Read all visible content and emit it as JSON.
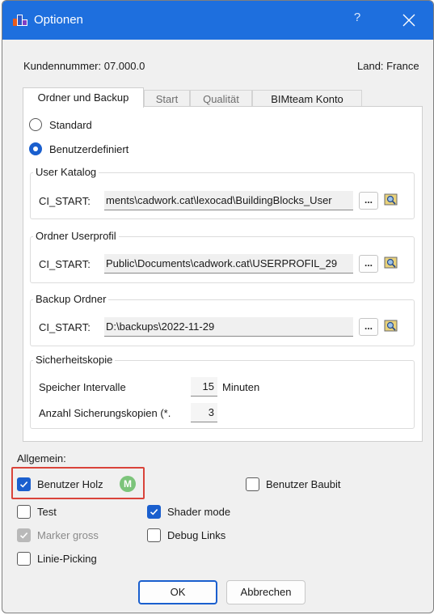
{
  "window": {
    "title": "Optionen",
    "help": "?"
  },
  "header": {
    "customer_number": "Kundennummer: 07.000.0",
    "country": "Land: France"
  },
  "tabs": [
    {
      "label": "Ordner und Backup",
      "state": "active"
    },
    {
      "label": "Start",
      "state": "inactive"
    },
    {
      "label": "Qualität",
      "state": "inactive"
    },
    {
      "label": "BIMteam Konto",
      "state": "normal"
    }
  ],
  "mode": {
    "standard": "Standard",
    "custom": "Benutzerdefiniert",
    "selected": "custom"
  },
  "user_catalog": {
    "title": "User Katalog",
    "label": "CI_START:",
    "value": "ments\\cadwork.cat\\lexocad\\BuildingBlocks_User"
  },
  "user_profile": {
    "title": "Ordner Userprofil",
    "label": "CI_START:",
    "value": "Public\\Documents\\cadwork.cat\\USERPROFIL_29"
  },
  "backup_folder": {
    "title": "Backup Ordner",
    "label": "CI_START:",
    "value": "D:\\backups\\2022-11-29"
  },
  "browse_label": "...",
  "safety_copy": {
    "title": "Sicherheitskopie",
    "interval_label": "Speicher Intervalle",
    "interval_value": "15",
    "interval_unit": "Minuten",
    "count_label": "Anzahl Sicherungskopien (*.",
    "count_value": "3"
  },
  "general": {
    "title": "Allgemein:",
    "benutzer_holz": {
      "label": "Benutzer Holz",
      "checked": true,
      "badge": "M"
    },
    "benutzer_baubit": {
      "label": "Benutzer Baubit",
      "checked": false
    },
    "test": {
      "label": "Test",
      "checked": false
    },
    "shader_mode": {
      "label": "Shader mode",
      "checked": true
    },
    "marker_gross": {
      "label": "Marker gross",
      "checked": true,
      "disabled": true
    },
    "debug_links": {
      "label": "Debug Links",
      "checked": false
    },
    "linie_picking": {
      "label": "Linie-Picking",
      "checked": false
    }
  },
  "buttons": {
    "ok": "OK",
    "cancel": "Abbrechen"
  },
  "colors": {
    "titlebar": "#1e6fde",
    "accent": "#1a5fce",
    "highlight": "#d9433a",
    "badge": "#7cc47a"
  }
}
